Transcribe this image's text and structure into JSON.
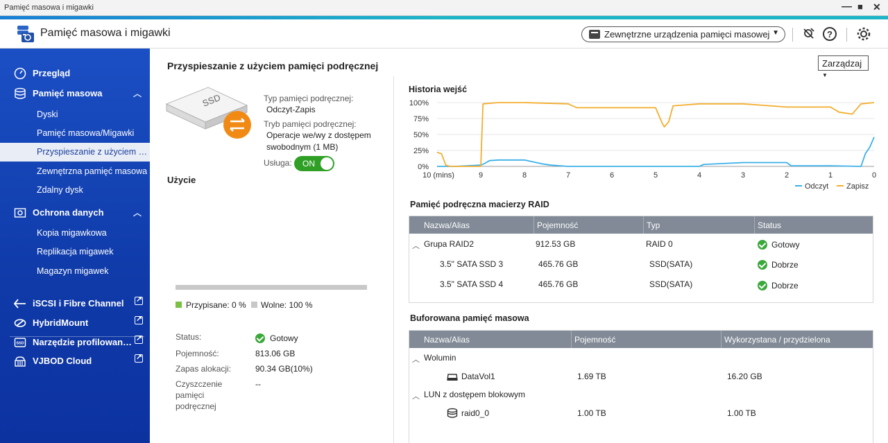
{
  "window": {
    "title": "Pamięć masowa i migawki",
    "controls": [
      "—",
      "■",
      "✕"
    ]
  },
  "header": {
    "app_title": "Pamięć masowa i migawki",
    "external_devices": "Zewnętrzne urządzenia pamięci masowej"
  },
  "sidebar": {
    "overview": "Przegląd",
    "storage": "Pamięć masowa",
    "storage_items": [
      "Dyski",
      "Pamięć masowa/Migawki",
      "Przyspieszanie z użyciem pa...",
      "Zewnętrzna pamięć masowa",
      "Zdalny dysk"
    ],
    "data_protection": "Ochrona danych",
    "protection_items": [
      "Kopia migawkowa",
      "Replikacja migawek",
      "Magazyn migawek"
    ],
    "links": [
      "iSCSI i Fibre Channel",
      "HybridMount",
      "Narzędzie profilowania ...",
      "VJBOD Cloud"
    ]
  },
  "main": {
    "title": "Przyspieszanie z użyciem pamięci podręcznej",
    "manage": "Zarządzaj",
    "ssd_label": "SSD",
    "cache_type_label": "Typ pamięci podręcznej:",
    "cache_type_value": "Odczyt-Zapis",
    "cache_mode_label": "Tryb pamięci podręcznej:",
    "cache_mode_value_1": "Operacje we/wy z dostępem",
    "cache_mode_value_2": "swobodnym (1 MB)",
    "service_label": "Usługa:",
    "service_value": "ON",
    "usage_title": "Użycie",
    "usage_fraction": 0,
    "written_legend": "Przypisane: 0 %",
    "free_legend": "Wolne: 100 %",
    "status_label": "Status:",
    "status_value": "Gotowy",
    "capacity_label": "Pojemność:",
    "capacity_value": "813.06 GB",
    "reserve_label": "Zapas alokacji:",
    "reserve_value": "90.34 GB(10%)",
    "clean_label_1": "Czyszczenie",
    "clean_label_2": "pamięci",
    "clean_label_3": "podręcznej",
    "clean_value": "--"
  },
  "colors": {
    "read": "#3ab0e8",
    "write": "#f2ae2e",
    "ok": "#3aa83a",
    "sidebar": "#1b4fc4"
  },
  "chart_data": {
    "type": "line",
    "title": "Historia wejść",
    "xlabel": "",
    "ylabel": "",
    "x_ticks": [
      "10 (mins)",
      "9",
      "8",
      "7",
      "6",
      "5",
      "4",
      "3",
      "2",
      "1",
      "0"
    ],
    "y_ticks": [
      "100%",
      "75%",
      "50%",
      "25%",
      "0%"
    ],
    "ylim": [
      0,
      100
    ],
    "xlim": [
      10,
      0
    ],
    "legend": "bottom-right",
    "series": [
      {
        "name": "Odczyt",
        "color": "#3ab0e8",
        "x": [
          10,
          9.9,
          9.6,
          9.0,
          8.9,
          8.8,
          8.6,
          8.0,
          7.6,
          7.4,
          7.0,
          4.0,
          3.9,
          3.0,
          2.0,
          1.9,
          1.0,
          0.3,
          0.2,
          0.1,
          0
        ],
        "y": [
          0,
          0,
          0,
          2,
          5,
          9,
          10,
          10,
          4,
          2,
          0,
          0,
          3,
          6,
          6,
          1,
          1,
          0,
          20,
          30,
          46
        ]
      },
      {
        "name": "Zapisz",
        "color": "#f2ae2e",
        "x": [
          10,
          9.9,
          9.8,
          9.7,
          9.0,
          8.95,
          8.6,
          8.0,
          7.0,
          6.8,
          5.0,
          4.85,
          4.8,
          4.7,
          4.6,
          4.0,
          3.0,
          2.0,
          1.0,
          0.8,
          0.5,
          0.3,
          0
        ],
        "y": [
          22,
          20,
          2,
          0,
          0,
          98,
          100,
          100,
          98,
          92,
          92,
          68,
          62,
          70,
          95,
          98,
          98,
          93,
          93,
          85,
          82,
          98,
          100
        ]
      }
    ]
  },
  "raid_cache": {
    "title": "Pamięć podręczna macierzy RAID",
    "columns": [
      "Nazwa/Alias",
      "Pojemność",
      "Typ",
      "Status"
    ],
    "rows": [
      {
        "name": "Grupa RAID2",
        "capacity": "912.53 GB",
        "type": "RAID 0",
        "status": "Gotowy"
      },
      {
        "name": "3.5\" SATA SSD 3",
        "capacity": "465.76 GB",
        "type": "SSD(SATA)",
        "status": "Dobrze"
      },
      {
        "name": "3.5\" SATA SSD 4",
        "capacity": "465.76 GB",
        "type": "SSD(SATA)",
        "status": "Dobrze"
      }
    ]
  },
  "buffered": {
    "title": "Buforowana pamięć masowa",
    "columns": [
      "Nazwa/Alias",
      "Pojemność",
      "Wykorzystana / przydzielona"
    ],
    "group1": "Wolumin",
    "row1": {
      "name": "DataVol1",
      "capacity": "1.69 TB",
      "used": "16.20 GB"
    },
    "group2": "LUN z dostępem blokowym",
    "row2": {
      "name": "raid0_0",
      "capacity": "1.00 TB",
      "used": "1.00 TB"
    }
  }
}
